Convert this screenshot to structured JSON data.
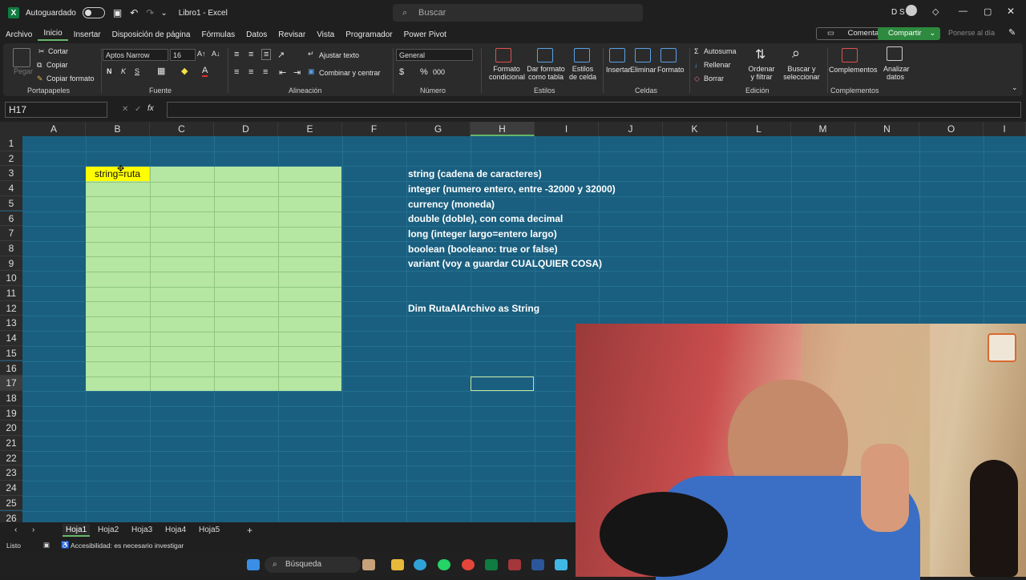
{
  "title_bar": {
    "autosave_label": "Autoguardado",
    "file_title": "Libro1 - Excel",
    "search_placeholder": "Buscar",
    "user_initials": "D S"
  },
  "menu": [
    "Archivo",
    "Inicio",
    "Insertar",
    "Disposición de página",
    "Fórmulas",
    "Datos",
    "Revisar",
    "Vista",
    "Programador",
    "Power Pivot"
  ],
  "menu_right": {
    "comments": "Comentarios",
    "share": "Compartir",
    "status": "Ponerse al día"
  },
  "ribbon": {
    "clipboard": {
      "paste": "Pegar",
      "cut": "Cortar",
      "copy": "Copiar",
      "format_painter": "Copiar formato",
      "label": "Portapapeles"
    },
    "font": {
      "name": "Aptos Narrow",
      "size": "16",
      "bold": "N",
      "italic": "K",
      "underline": "S",
      "label": "Fuente"
    },
    "alignment": {
      "wrap": "Ajustar texto",
      "merge": "Combinar y centrar",
      "label": "Alineación"
    },
    "number": {
      "format": "General",
      "currency": "$",
      "percent": "%",
      "thousands": "000",
      "label": "Número"
    },
    "styles": {
      "conditional": "Formato condicional",
      "table": "Dar formato como tabla",
      "cell_styles": "Estilos de celda",
      "label": "Estilos"
    },
    "cells": {
      "insert": "Insertar",
      "delete": "Eliminar",
      "format": "Formato",
      "label": "Celdas"
    },
    "editing": {
      "autosum": "Autosuma",
      "fill": "Rellenar",
      "clear": "Borrar",
      "sort": "Ordenar y filtrar",
      "find": "Buscar y seleccionar",
      "label": "Edición"
    },
    "addins": {
      "complements": "Complementos",
      "analyze": "Analizar datos",
      "label": "Complementos"
    }
  },
  "formula_bar": {
    "name_box": "H17",
    "fx": "fx",
    "content": ""
  },
  "columns": [
    "A",
    "B",
    "C",
    "D",
    "E",
    "F",
    "G",
    "H",
    "I",
    "J",
    "K",
    "L",
    "M",
    "N",
    "O",
    "I"
  ],
  "rows": [
    "1",
    "2",
    "3",
    "4",
    "5",
    "6",
    "7",
    "8",
    "9",
    "10",
    "11",
    "12",
    "13",
    "14",
    "15",
    "16",
    "17",
    "18",
    "19",
    "20",
    "21",
    "22",
    "23",
    "24",
    "25",
    "26"
  ],
  "cells": {
    "B3": "string=ruta",
    "notes": [
      "string (cadena de caracteres)",
      "integer (numero entero, entre -32000 y 32000)",
      "currency (moneda)",
      "double (doble), con coma decimal",
      "long (integer largo=entero largo)",
      "boolean (booleano: true or false)",
      "variant (voy a guardar CUALQUIER COSA)"
    ],
    "G12": "Dim RutaAlArchivo as String"
  },
  "sheets": [
    "Hoja1",
    "Hoja2",
    "Hoja3",
    "Hoja4",
    "Hoja5"
  ],
  "status_bar": {
    "ready": "Listo",
    "accessibility": "Accesibilidad: es necesario investigar"
  },
  "taskbar": {
    "search": "Búsqueda"
  },
  "colors": {
    "grid_bg": "#1a5f7f",
    "green_fill": "#b5e6a2",
    "yellow_fill": "#ffff00",
    "excel_green": "#107c41"
  }
}
